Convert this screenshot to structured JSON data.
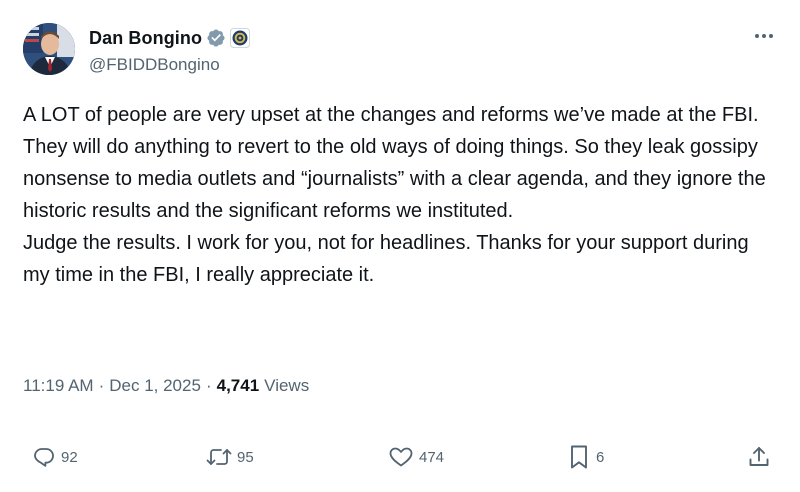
{
  "author": {
    "display_name": "Dan Bongino",
    "handle": "@FBIDDBongino",
    "verified": true,
    "affiliation_badge": "fbi-seal-icon",
    "avatar": "avatar"
  },
  "tweet": {
    "lines": [
      "A LOT of people are very upset at the changes and reforms we’ve made at the FBI.",
      "They will do anything to revert to the old ways of doing things. So they leak gossipy nonsense to media outlets and “journalists” with a clear agenda, and they ignore the historic results and the significant reforms we instituted.",
      "Judge the results. I work for you, not for headlines. Thanks for your support during my time in the FBI, I really appreciate it."
    ]
  },
  "meta": {
    "time": "11:19 AM",
    "separator": "·",
    "date": "Dec 1, 2025",
    "views_count": "4,741",
    "views_label": "Views"
  },
  "actions": {
    "replies": "92",
    "reposts": "95",
    "likes": "474",
    "bookmarks": "6"
  },
  "colors": {
    "text": "#0f1419",
    "secondary": "#536471",
    "verified_badge": "#829aab"
  }
}
